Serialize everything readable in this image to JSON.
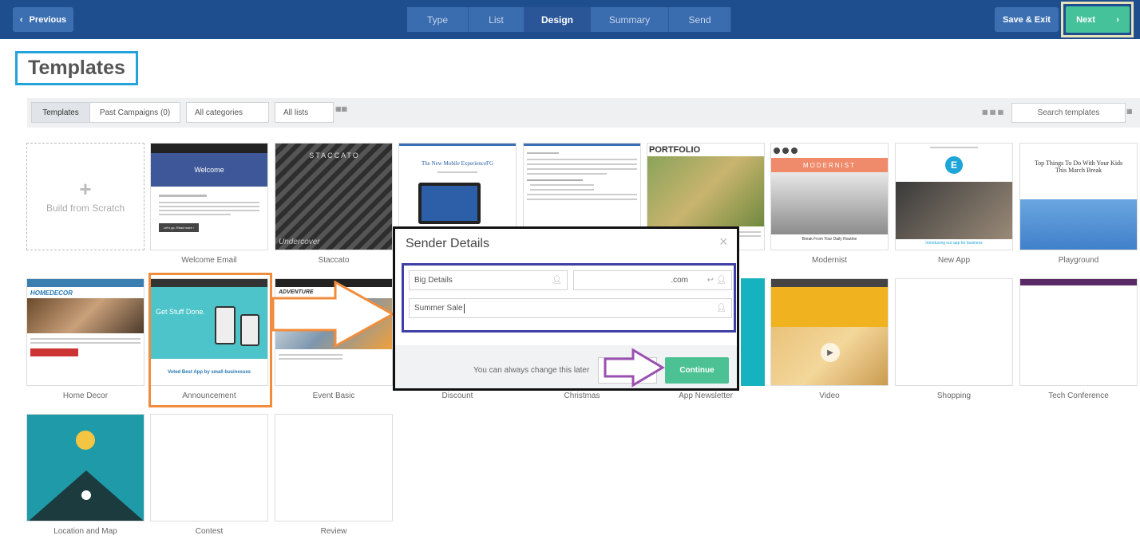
{
  "nav": {
    "previous_label": "Previous",
    "save_label": "Save & Exit",
    "next_label": "Next",
    "steps": [
      {
        "label": "Type",
        "active": false
      },
      {
        "label": "List",
        "active": false
      },
      {
        "label": "Design",
        "active": true
      },
      {
        "label": "Summary",
        "active": false
      },
      {
        "label": "Send",
        "active": false
      }
    ]
  },
  "page_title": "Templates",
  "filters": {
    "tabs": [
      "Templates",
      "Past Campaigns (0)"
    ],
    "categories": "All categories",
    "lists": "All lists",
    "search_placeholder": "Search templates"
  },
  "templates": [
    {
      "name": "Build from Scratch"
    },
    {
      "name": "Welcome Email",
      "preview_title": "Welcome",
      "preview_button": "Let's go. Read more ›"
    },
    {
      "name": "Staccato",
      "preview_title": "STACCATO",
      "preview_text": "Undercover"
    },
    {
      "name": "",
      "preview_title": "The New Mobile ExperienceFG"
    },
    {
      "name": ""
    },
    {
      "name": "",
      "preview_title": "PORTFOLIO"
    },
    {
      "name": "Modernist",
      "preview_title": "MODERNIST",
      "preview_text": "Break From Your Daily Routine"
    },
    {
      "name": "New App",
      "preview_text": "Introducing our app for business"
    },
    {
      "name": "Playground",
      "preview_title": "Top Things To Do With Your Kids This March Break"
    },
    {
      "name": "Home Decor",
      "preview_title": "HOMEDECOR"
    },
    {
      "name": "Announcement",
      "preview_title": "Get Stuff Done.",
      "preview_text": "Voted Best App by small businesses"
    },
    {
      "name": "Event Basic",
      "preview_title": "ADVENTURE"
    },
    {
      "name": "Discount"
    },
    {
      "name": "Christmas"
    },
    {
      "name": "App Newsletter"
    },
    {
      "name": "Video"
    },
    {
      "name": "Shopping"
    },
    {
      "name": "Tech Conference"
    },
    {
      "name": "Location and Map"
    },
    {
      "name": "Contest"
    },
    {
      "name": "Review"
    }
  ],
  "dialog": {
    "title": "Sender Details",
    "close": "×",
    "from_name": "Big Details",
    "from_email": ".com",
    "subject": "Summer Sale",
    "note": "You can always change this later",
    "continue_label": "Continue"
  },
  "colors": {
    "nav_bg": "#1f4e8f",
    "accent_green": "#46c29b",
    "title_outline": "#22a4db",
    "annotation_orange": "#f18c3c",
    "annotation_purple": "#9a4fb0",
    "annotation_blue": "#3f3fa6"
  }
}
